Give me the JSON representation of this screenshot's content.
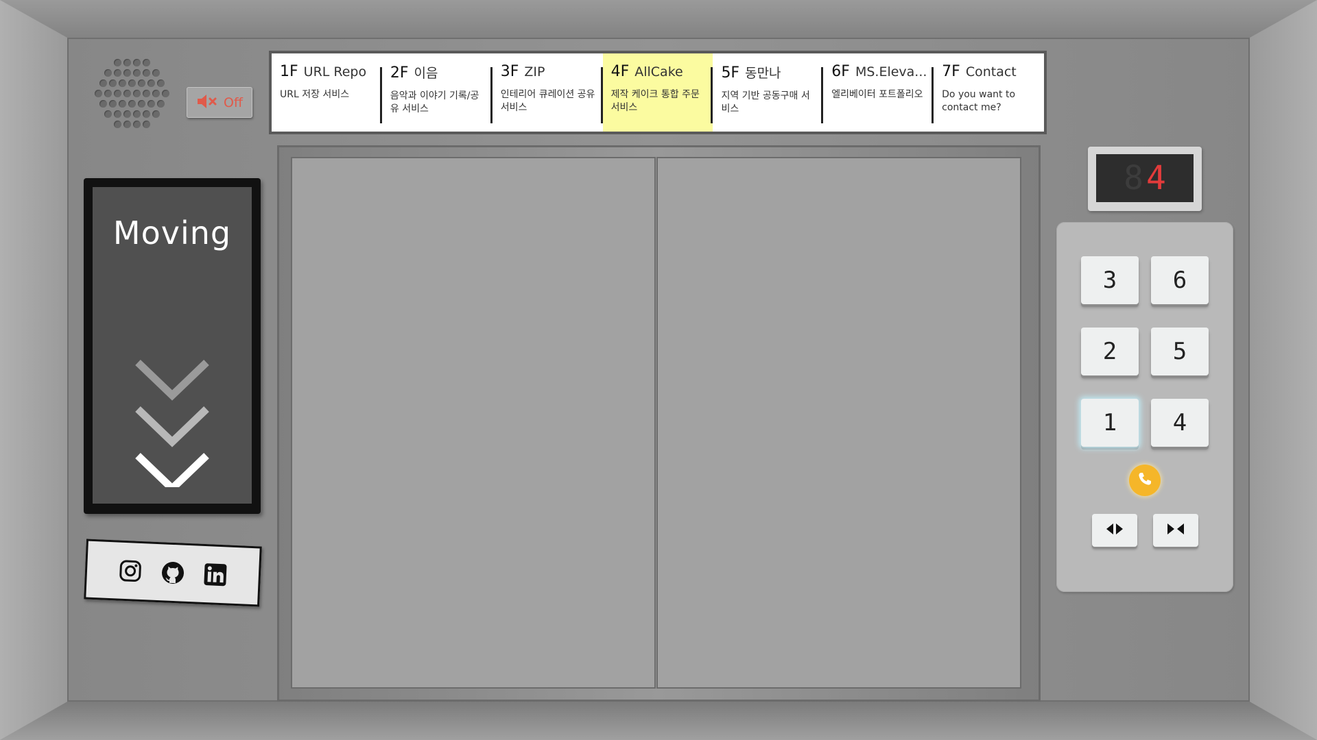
{
  "sound": {
    "label": "Off",
    "icon": "muted-speaker-icon",
    "color": "#e05a4a"
  },
  "directory": {
    "active_floor": "4F",
    "highlight_color": "#fbfba0",
    "floors": [
      {
        "num": "1F",
        "name": "URL Repo",
        "desc": "URL 저장 서비스"
      },
      {
        "num": "2F",
        "name": "이음",
        "desc": "음악과 이야기 기록/공유 서비스"
      },
      {
        "num": "3F",
        "name": "ZIP",
        "desc": "인테리어 큐레이션 공유 서비스"
      },
      {
        "num": "4F",
        "name": "AllCake",
        "desc": "제작 케이크 통합 주문 서비스"
      },
      {
        "num": "5F",
        "name": "동만나",
        "desc": "지역 기반 공동구매 서비스"
      },
      {
        "num": "6F",
        "name": "MS.Eleva...",
        "desc": "엘리베이터 포트폴리오"
      },
      {
        "num": "7F",
        "name": "Contact",
        "desc": "Do you want to contact me?"
      }
    ]
  },
  "status": {
    "text": "Moving",
    "direction": "down"
  },
  "social": [
    {
      "icon": "instagram-icon"
    },
    {
      "icon": "github-icon"
    },
    {
      "icon": "linkedin-icon"
    }
  ],
  "indicator": {
    "ghost": "8",
    "current": "4",
    "color": "#e23b3b"
  },
  "panel": {
    "buttons": [
      "3",
      "6",
      "2",
      "5",
      "1",
      "4"
    ],
    "lit": "1",
    "call_icon": "phone-icon",
    "call_color": "#f5b629",
    "open_icon": "door-open-icon",
    "close_icon": "door-close-icon"
  }
}
